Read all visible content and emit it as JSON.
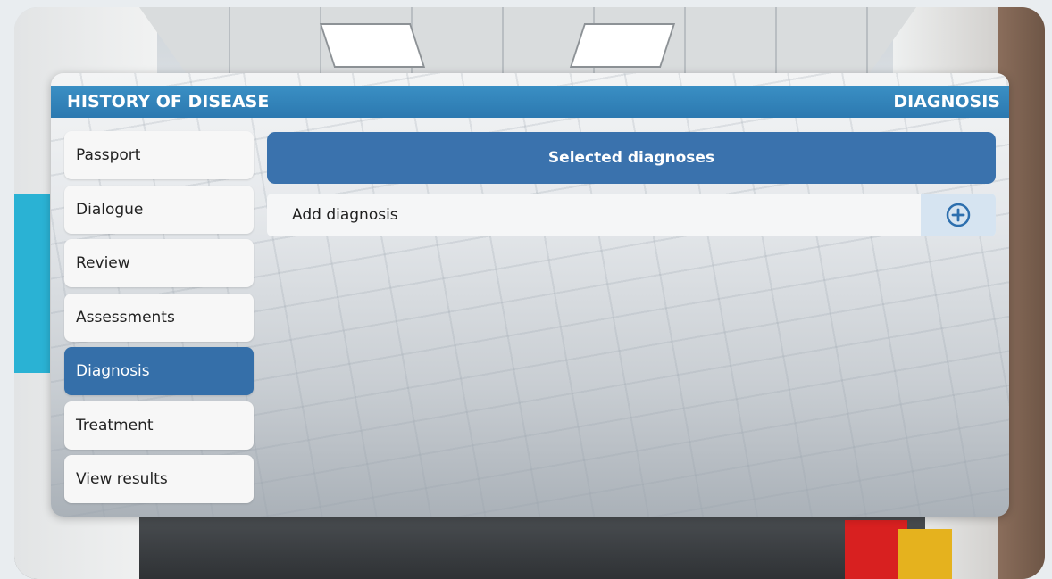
{
  "header": {
    "title": "HISTORY OF DISEASE",
    "section": "DIAGNOSIS"
  },
  "nav": {
    "items": [
      {
        "label": "Passport"
      },
      {
        "label": "Dialogue"
      },
      {
        "label": "Review"
      },
      {
        "label": "Assessments"
      },
      {
        "label": "Diagnosis",
        "active": true
      },
      {
        "label": "Treatment"
      },
      {
        "label": "View results"
      }
    ]
  },
  "main": {
    "selected_label": "Selected diagnoses",
    "add_label": "Add diagnosis",
    "add_icon": "plus-circle-icon"
  },
  "colors": {
    "header": "#2c79b0",
    "active": "#356fa9",
    "accent": "#3a72ad"
  }
}
